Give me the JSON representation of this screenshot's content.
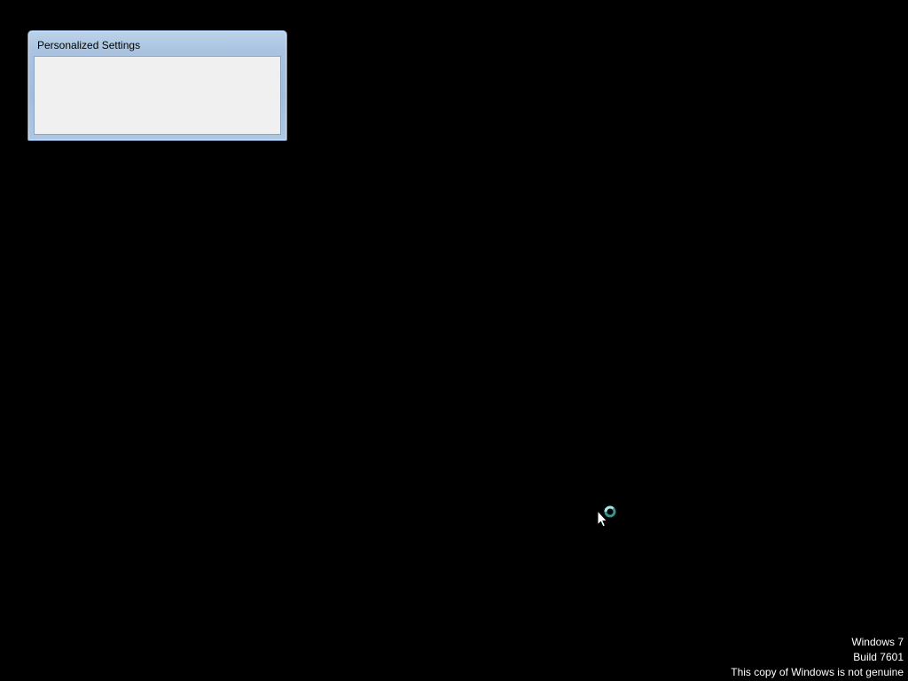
{
  "dialog": {
    "title": "Personalized Settings"
  },
  "cursor": {
    "icon": "busy-pointer-icon"
  },
  "watermark": {
    "line1": "Windows 7",
    "line2": "Build 7601",
    "line3": "This copy of Windows is not genuine"
  },
  "colors": {
    "desktop_background": "#000000",
    "dialog_frame": "#a9c3e0",
    "dialog_body": "#f0f0f0",
    "busy_ring": "#5fc8c8"
  }
}
